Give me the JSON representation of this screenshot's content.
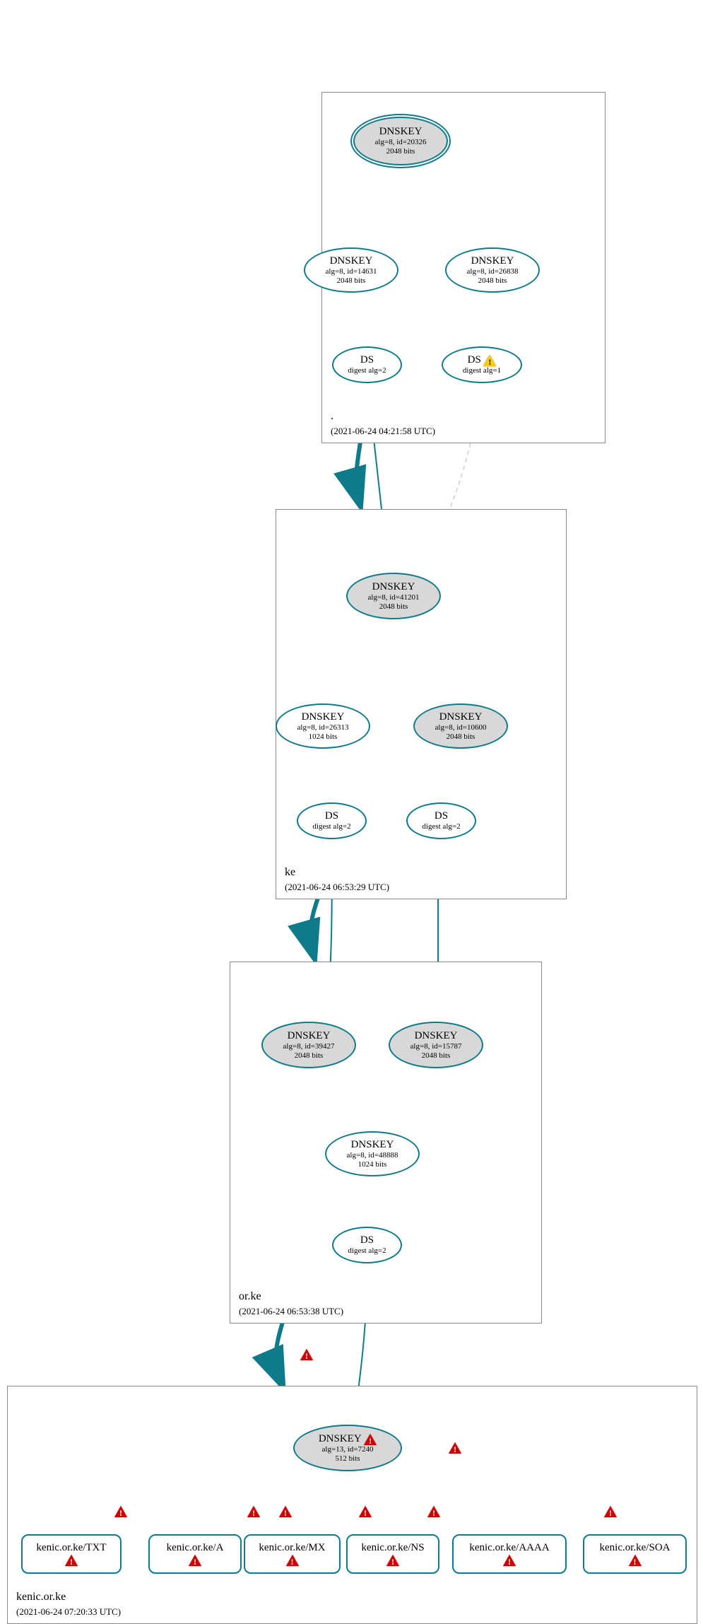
{
  "zones": {
    "root": {
      "name": ".",
      "timestamp": "(2021-06-24 04:21:58 UTC)"
    },
    "ke": {
      "name": "ke",
      "timestamp": "(2021-06-24 06:53:29 UTC)"
    },
    "orke": {
      "name": "or.ke",
      "timestamp": "(2021-06-24 06:53:38 UTC)"
    },
    "kenic": {
      "name": "kenic.or.ke",
      "timestamp": "(2021-06-24 07:20:33 UTC)"
    }
  },
  "nodes": {
    "root_ksk": {
      "title": "DNSKEY",
      "line2": "alg=8, id=20326",
      "line3": "2048 bits"
    },
    "root_zsk1": {
      "title": "DNSKEY",
      "line2": "alg=8, id=14631",
      "line3": "2048 bits"
    },
    "root_zsk2": {
      "title": "DNSKEY",
      "line2": "alg=8, id=26838",
      "line3": "2048 bits"
    },
    "root_ds2": {
      "title": "DS",
      "line2": "digest alg=2"
    },
    "root_ds1": {
      "title": "DS",
      "line2": "digest alg=1"
    },
    "ke_ksk": {
      "title": "DNSKEY",
      "line2": "alg=8, id=41201",
      "line3": "2048 bits"
    },
    "ke_zsk": {
      "title": "DNSKEY",
      "line2": "alg=8, id=26313",
      "line3": "1024 bits"
    },
    "ke_key2": {
      "title": "DNSKEY",
      "line2": "alg=8, id=10600",
      "line3": "2048 bits"
    },
    "ke_ds1": {
      "title": "DS",
      "line2": "digest alg=2"
    },
    "ke_ds2": {
      "title": "DS",
      "line2": "digest alg=2"
    },
    "orke_ksk1": {
      "title": "DNSKEY",
      "line2": "alg=8, id=39427",
      "line3": "2048 bits"
    },
    "orke_ksk2": {
      "title": "DNSKEY",
      "line2": "alg=8, id=15787",
      "line3": "2048 bits"
    },
    "orke_zsk": {
      "title": "DNSKEY",
      "line2": "alg=8, id=48888",
      "line3": "1024 bits"
    },
    "orke_ds": {
      "title": "DS",
      "line2": "digest alg=2"
    },
    "kenic_key": {
      "title": "DNSKEY",
      "line2": "alg=13, id=7240",
      "line3": "512 bits"
    },
    "rr_txt": {
      "label": "kenic.or.ke/TXT"
    },
    "rr_a": {
      "label": "kenic.or.ke/A"
    },
    "rr_mx": {
      "label": "kenic.or.ke/MX"
    },
    "rr_ns": {
      "label": "kenic.or.ke/NS"
    },
    "rr_aaaa": {
      "label": "kenic.or.ke/AAAA"
    },
    "rr_soa": {
      "label": "kenic.or.ke/SOA"
    }
  },
  "icons": {
    "warning_yellow": "warning",
    "warning_red": "error"
  }
}
